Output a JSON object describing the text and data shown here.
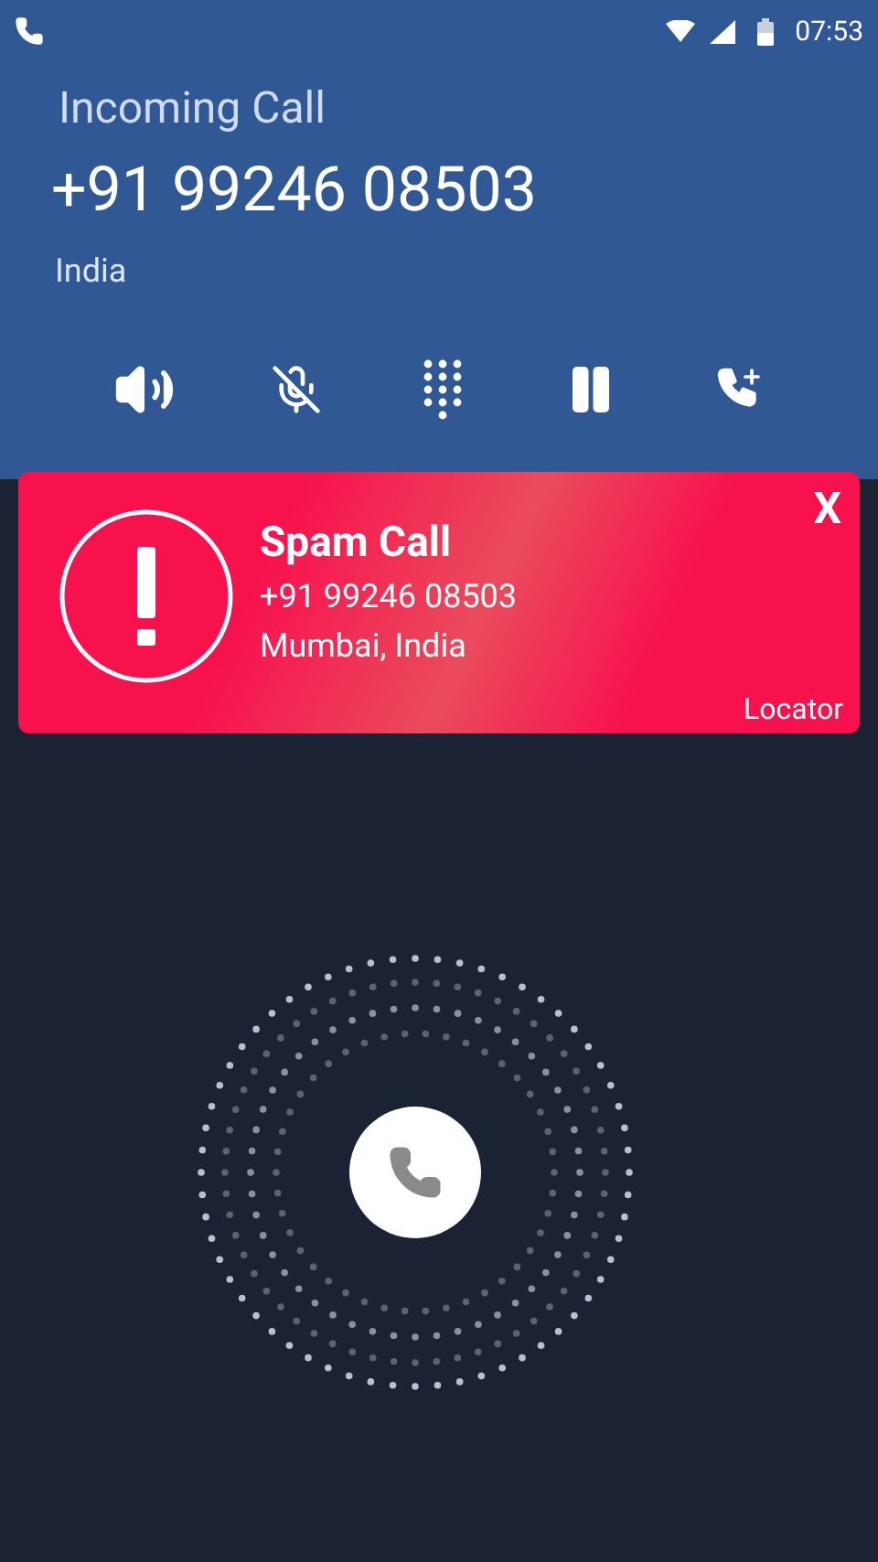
{
  "status_bar": {
    "time": "07:53"
  },
  "call": {
    "status": "Incoming Call",
    "number": "+91 99246 08503",
    "country": "India"
  },
  "controls": [
    {
      "kind": "speaker"
    },
    {
      "kind": "mute"
    },
    {
      "kind": "dialpad"
    },
    {
      "kind": "hold"
    },
    {
      "kind": "add_call"
    }
  ],
  "spam_card": {
    "title": "Spam Call",
    "number": "+91 99246 08503",
    "location": "Mumbai, India",
    "close": "X",
    "brand": "Locator"
  }
}
